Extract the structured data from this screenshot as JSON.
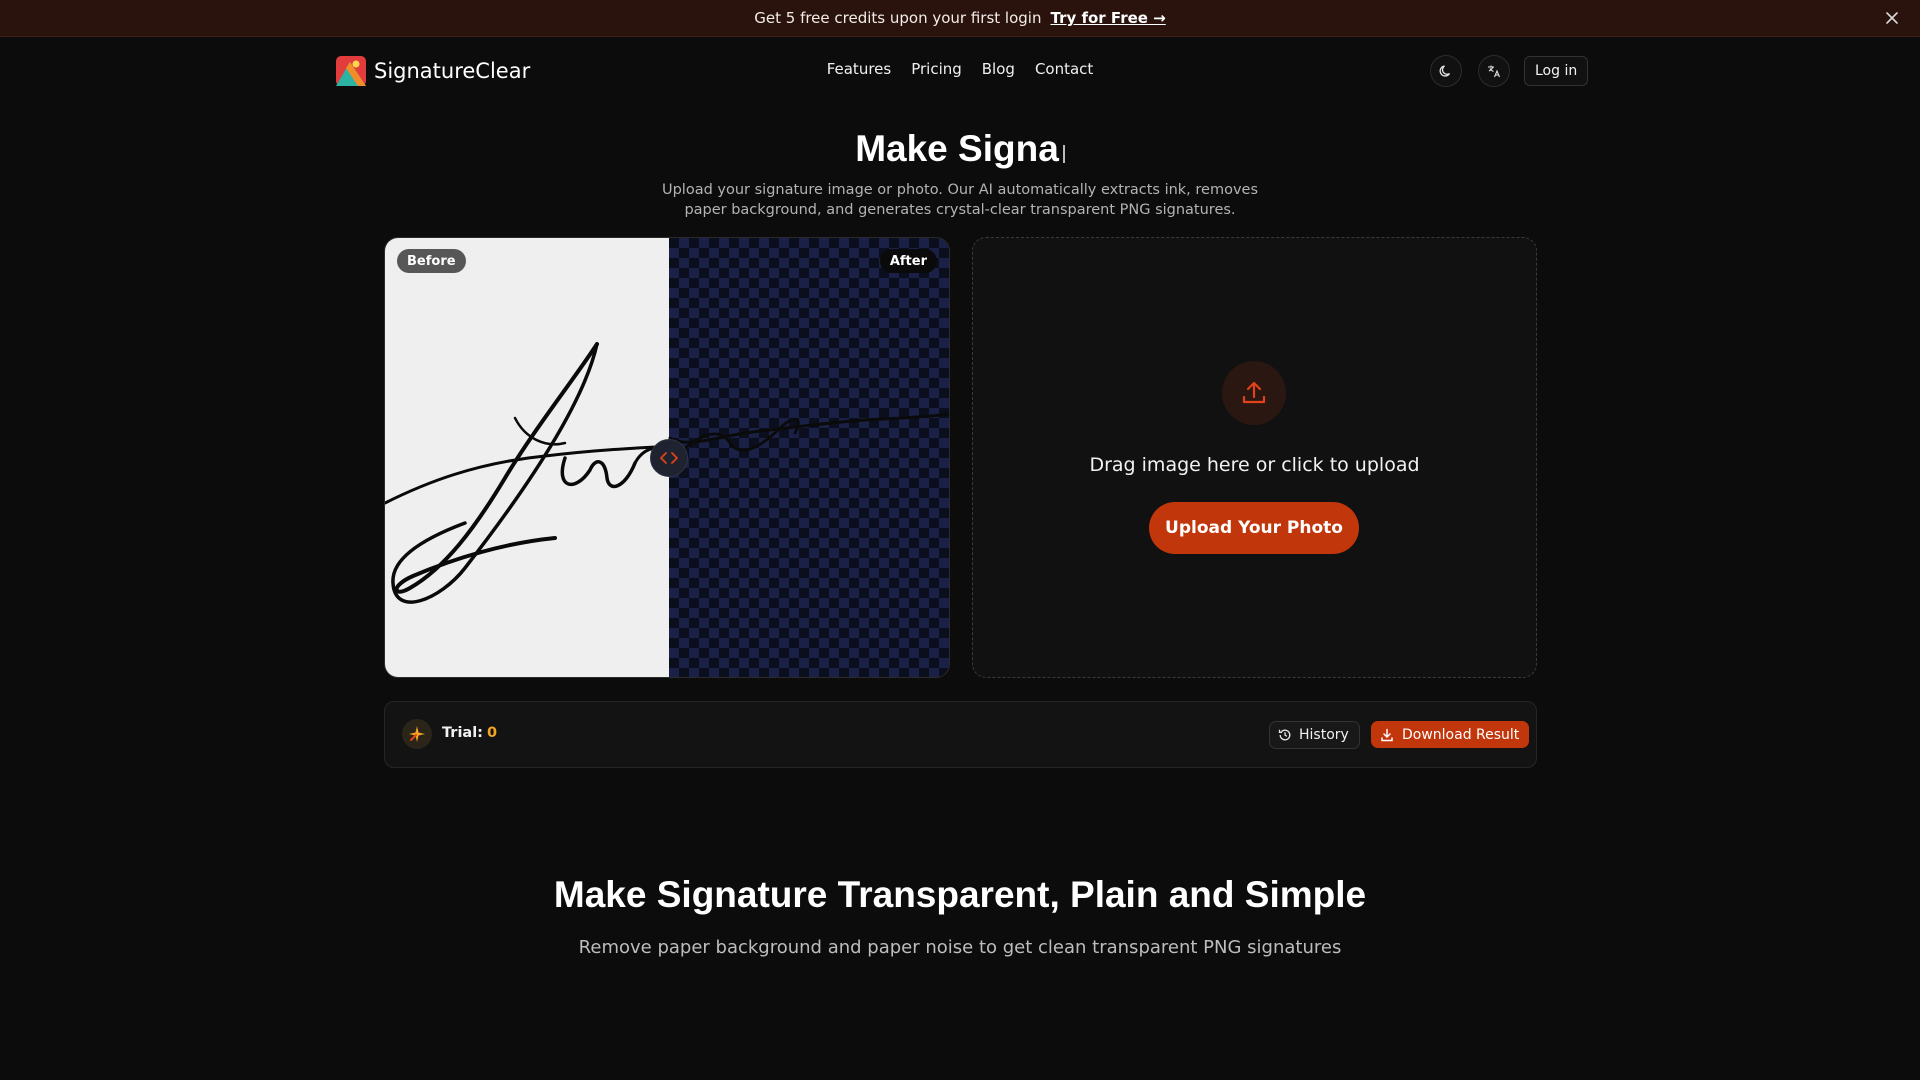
{
  "promo": {
    "text": "Get 5 free credits upon your first login",
    "cta": "Try for Free →",
    "close_icon": "close-icon"
  },
  "header": {
    "brand": "SignatureClear",
    "nav": [
      "Features",
      "Pricing",
      "Blog",
      "Contact"
    ],
    "theme_icon": "moon-icon",
    "language_icon": "translate-icon",
    "login": "Log in"
  },
  "hero": {
    "title": "Make Signa",
    "subtitle": "Upload your signature image or photo. Our AI automatically extracts ink, removes paper background, and generates crystal-clear transparent PNG signatures."
  },
  "compare": {
    "before_label": "Before",
    "after_label": "After",
    "handle_icon": "code-arrows-icon"
  },
  "upload": {
    "icon": "upload-icon",
    "prompt": "Drag image here or click to upload",
    "button": "Upload Your Photo"
  },
  "toolbar": {
    "trial_icon": "sparkle-icon",
    "trial_label": "Trial:",
    "trial_count": "0",
    "history": "History",
    "history_icon": "history-icon",
    "download": "Download Result",
    "download_icon": "download-icon"
  },
  "section": {
    "title": "Make Signature Transparent, Plain and Simple",
    "subtitle": "Remove paper background and paper noise to get clean transparent PNG signatures"
  },
  "colors": {
    "accent": "#c2360c",
    "background": "#0c0c0c",
    "trial_count": "#f5a623"
  }
}
